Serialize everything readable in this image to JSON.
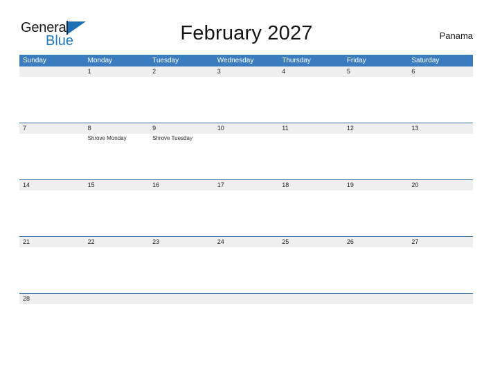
{
  "brand": {
    "name_part1": "General",
    "name_part2": "Blue",
    "flag_icon": "flag-icon",
    "primary_color": "#1f7ac4"
  },
  "header": {
    "title": "February 2027",
    "country": "Panama"
  },
  "calendar": {
    "month": "February",
    "year": "2027",
    "header_bg": "#3a7cbe",
    "band_bg": "#efefef",
    "rule_color": "#2e6da4",
    "weekdays": [
      "Sunday",
      "Monday",
      "Tuesday",
      "Wednesday",
      "Thursday",
      "Friday",
      "Saturday"
    ],
    "weeks": [
      [
        {
          "date": "",
          "events": []
        },
        {
          "date": "1",
          "events": []
        },
        {
          "date": "2",
          "events": []
        },
        {
          "date": "3",
          "events": []
        },
        {
          "date": "4",
          "events": []
        },
        {
          "date": "5",
          "events": []
        },
        {
          "date": "6",
          "events": []
        }
      ],
      [
        {
          "date": "7",
          "events": []
        },
        {
          "date": "8",
          "events": [
            "Shrove Monday"
          ]
        },
        {
          "date": "9",
          "events": [
            "Shrove Tuesday"
          ]
        },
        {
          "date": "10",
          "events": []
        },
        {
          "date": "11",
          "events": []
        },
        {
          "date": "12",
          "events": []
        },
        {
          "date": "13",
          "events": []
        }
      ],
      [
        {
          "date": "14",
          "events": []
        },
        {
          "date": "15",
          "events": []
        },
        {
          "date": "16",
          "events": []
        },
        {
          "date": "17",
          "events": []
        },
        {
          "date": "18",
          "events": []
        },
        {
          "date": "19",
          "events": []
        },
        {
          "date": "20",
          "events": []
        }
      ],
      [
        {
          "date": "21",
          "events": []
        },
        {
          "date": "22",
          "events": []
        },
        {
          "date": "23",
          "events": []
        },
        {
          "date": "24",
          "events": []
        },
        {
          "date": "25",
          "events": []
        },
        {
          "date": "26",
          "events": []
        },
        {
          "date": "27",
          "events": []
        }
      ],
      [
        {
          "date": "28",
          "events": []
        },
        {
          "date": "",
          "events": []
        },
        {
          "date": "",
          "events": []
        },
        {
          "date": "",
          "events": []
        },
        {
          "date": "",
          "events": []
        },
        {
          "date": "",
          "events": []
        },
        {
          "date": "",
          "events": []
        }
      ]
    ]
  }
}
